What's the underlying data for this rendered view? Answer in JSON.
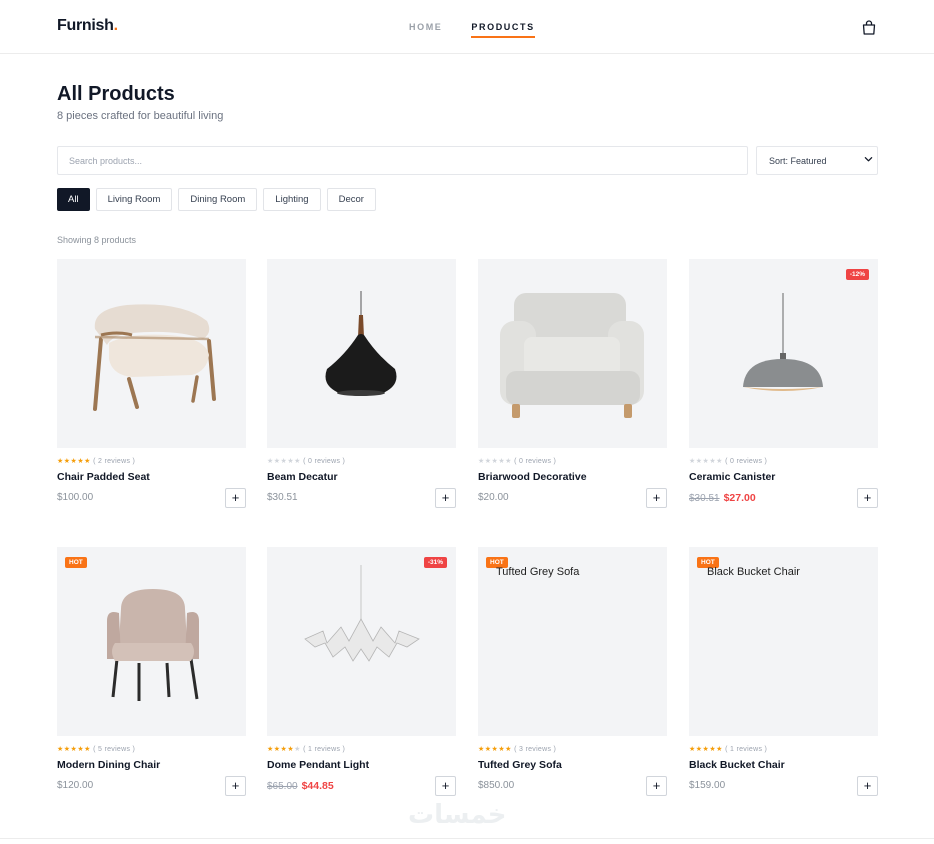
{
  "brand": {
    "name": "Furnish",
    "dot": "."
  },
  "nav": {
    "items": [
      {
        "label": "HOME"
      },
      {
        "label": "PRODUCTS"
      }
    ]
  },
  "page": {
    "title": "All Products",
    "subtitle": "8 pieces crafted for beautiful living",
    "showing": "Showing 8 products"
  },
  "search": {
    "placeholder": "Search products...",
    "value": ""
  },
  "sort": {
    "selected": "Sort: Featured"
  },
  "filters": [
    {
      "label": "All"
    },
    {
      "label": "Living Room"
    },
    {
      "label": "Dining Room"
    },
    {
      "label": "Lighting"
    },
    {
      "label": "Decor"
    }
  ],
  "products": [
    {
      "name": "Chair Padded Seat",
      "rating": 5,
      "reviews": "( 2 reviews )",
      "price": "$100.00",
      "old_price": "",
      "badge": ""
    },
    {
      "name": "Beam Decatur",
      "rating": 0,
      "reviews": "( 0 reviews )",
      "price": "$30.51",
      "old_price": "",
      "badge": ""
    },
    {
      "name": "Briarwood Decorative",
      "rating": 0,
      "reviews": "( 0 reviews )",
      "price": "$20.00",
      "old_price": "",
      "badge": ""
    },
    {
      "name": "Ceramic Canister",
      "rating": 0,
      "reviews": "( 0 reviews )",
      "price": "$27.00",
      "old_price": "$30.51",
      "badge": "-12%"
    },
    {
      "name": "Modern Dining Chair",
      "rating": 5,
      "reviews": "( 5 reviews )",
      "price": "$120.00",
      "old_price": "",
      "badge": "HOT"
    },
    {
      "name": "Dome Pendant Light",
      "rating": 4,
      "reviews": "( 1 reviews )",
      "price": "$44.85",
      "old_price": "$65.00",
      "badge": "-31%"
    },
    {
      "name": "Tufted Grey Sofa",
      "rating": 5,
      "reviews": "( 3 reviews )",
      "price": "$850.00",
      "old_price": "",
      "badge": "HOT",
      "broken_image_alt": "Tufted Grey Sofa"
    },
    {
      "name": "Black Bucket Chair",
      "rating": 5,
      "reviews": "( 1 reviews )",
      "price": "$159.00",
      "old_price": "",
      "badge": "HOT",
      "broken_image_alt": "Black Bucket Chair"
    }
  ],
  "add_button": {
    "label": "+"
  },
  "watermark": "خمسات",
  "colors": {
    "accent": "#f97316",
    "sale": "#ef4444",
    "star": "#f59e0b",
    "dark": "#111827",
    "card_bg": "#f3f4f6"
  }
}
